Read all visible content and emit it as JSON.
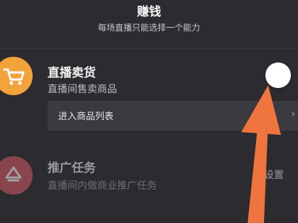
{
  "header": {
    "title": "赚钱",
    "subtitle": "每场直播只能选择一个能力"
  },
  "live_selling": {
    "icon": "cart-icon",
    "icon_color": "#f2a33a",
    "title": "直播卖货",
    "description": "直播间售卖商品",
    "toggle_on": false,
    "entry_label": "进入商品列表",
    "entry_chevron": "›"
  },
  "promotion_task": {
    "icon": "promotion-icon",
    "icon_color": "#d55a63",
    "title": "推广任务",
    "description": "直播间内做商业推广任务",
    "setting_label": "设置"
  },
  "annotation": {
    "arrow_color": "#f0743d"
  }
}
